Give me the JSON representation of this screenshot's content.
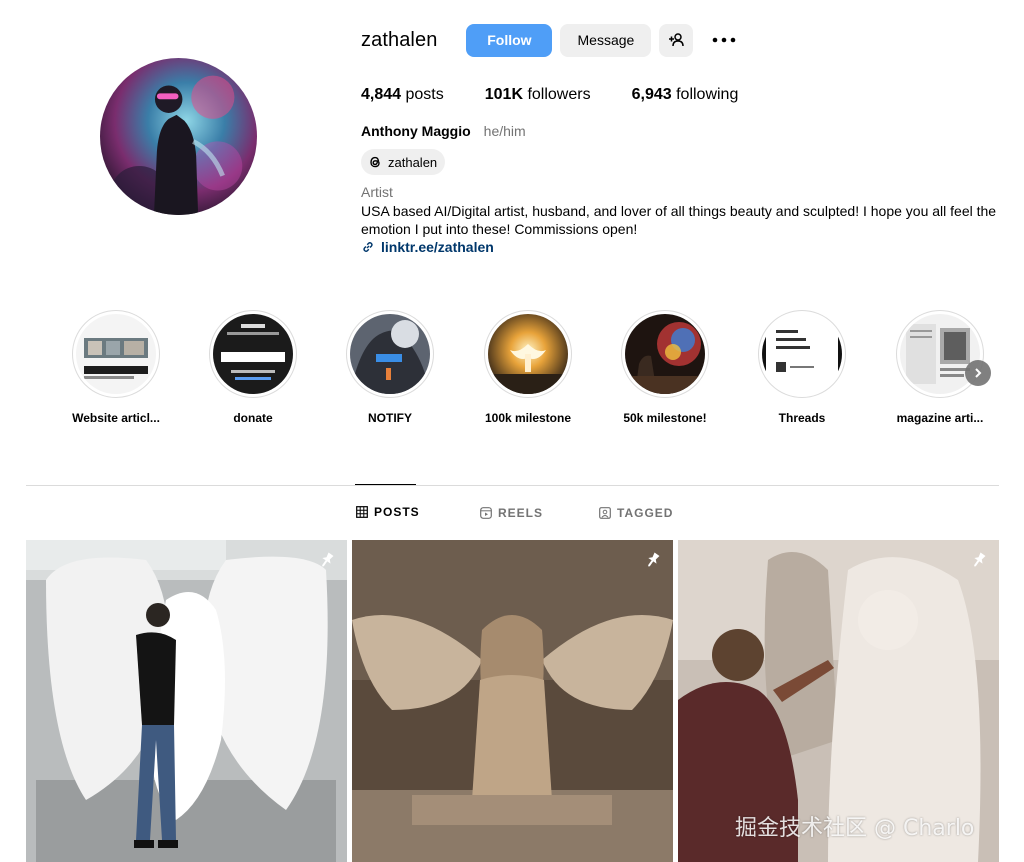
{
  "profile": {
    "username": "zathalen",
    "follow_label": "Follow",
    "message_label": "Message",
    "stats": {
      "posts_count": "4,844",
      "posts_label": "posts",
      "followers_count": "101K",
      "followers_label": "followers",
      "following_count": "6,943",
      "following_label": "following"
    },
    "full_name": "Anthony Maggio",
    "pronouns": "he/him",
    "threads_handle": "zathalen",
    "category": "Artist",
    "bio": "USA based AI/Digital artist, husband, and lover of all things beauty and sculpted! I hope you all feel the emotion I put into these! Commissions open!",
    "link": "linktr.ee/zathalen"
  },
  "highlights": [
    {
      "label": "Website articl..."
    },
    {
      "label": "donate"
    },
    {
      "label": "NOTIFY"
    },
    {
      "label": "100k milestone"
    },
    {
      "label": "50k milestone!"
    },
    {
      "label": "Threads"
    },
    {
      "label": "magazine arti..."
    }
  ],
  "tabs": {
    "posts": "POSTS",
    "reels": "REELS",
    "tagged": "TAGGED"
  },
  "watermark": "掘金技术社区 @ Charlo",
  "icons": {
    "add_user": "add-user-icon",
    "more": "more-icon",
    "threads": "threads-icon",
    "link": "link-icon",
    "pin": "pin-icon",
    "grid": "grid-icon",
    "reels": "reels-icon",
    "tagged": "tagged-icon",
    "next": "chevron-right-icon"
  },
  "colors": {
    "follow_button": "#4f9ef7",
    "secondary_button": "#efefef",
    "link": "#00376b",
    "muted_text": "#737373"
  }
}
